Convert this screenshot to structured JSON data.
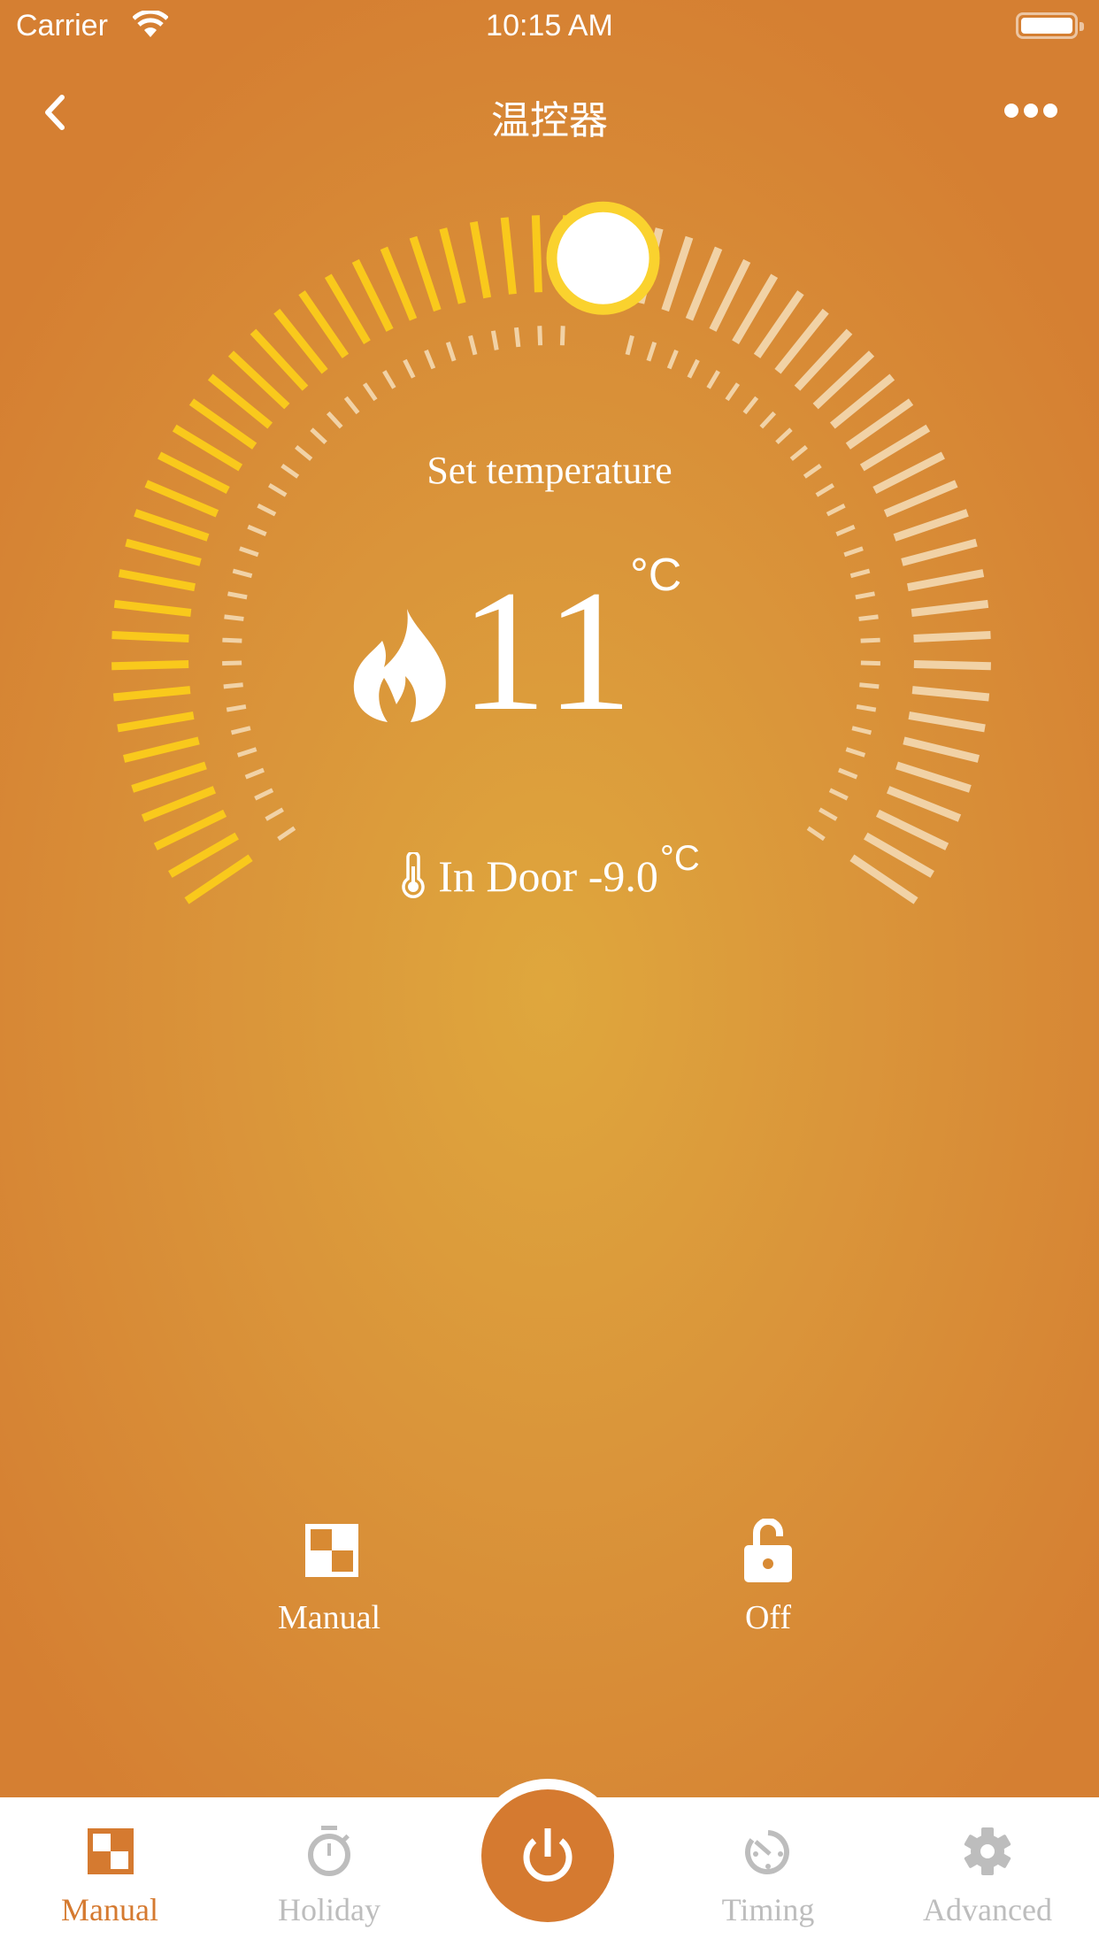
{
  "status_bar": {
    "carrier": "Carrier",
    "time": "10:15 AM",
    "wifi_icon": "wifi-icon",
    "battery_icon": "battery-full-icon"
  },
  "nav": {
    "title": "温控器",
    "back_icon": "chevron-left-icon",
    "more_icon": "more-horizontal-icon"
  },
  "thermostat": {
    "set_label": "Set temperature",
    "set_value": "11",
    "set_unit": "°C",
    "mode_icon": "flame-icon",
    "indoor_label": "In Door",
    "indoor_value": "-9.0",
    "indoor_unit": "°C",
    "indoor_icon": "thermometer-icon",
    "dial": {
      "position_fraction": 0.53,
      "tick_count": 62,
      "colors": {
        "active": "#F9C91C",
        "inactive": "#F1D2A6",
        "knob_ring": "#FAD22E",
        "knob_fill": "#FFFFFF"
      }
    }
  },
  "quick_actions": [
    {
      "label": "Manual",
      "icon": "manual-mode-icon"
    },
    {
      "label": "Off",
      "icon": "unlock-icon"
    }
  ],
  "tabs": [
    {
      "label": "Manual",
      "icon": "manual-mode-icon",
      "active": true
    },
    {
      "label": "Holiday",
      "icon": "stopwatch-icon",
      "active": false
    },
    {
      "label": "Timing",
      "icon": "timer-icon",
      "active": false
    },
    {
      "label": "Advanced",
      "icon": "gear-icon",
      "active": false
    }
  ],
  "power_button": {
    "icon": "power-icon"
  },
  "colors": {
    "accent": "#D57A30",
    "inactive_tab": "#BDBDBD"
  }
}
